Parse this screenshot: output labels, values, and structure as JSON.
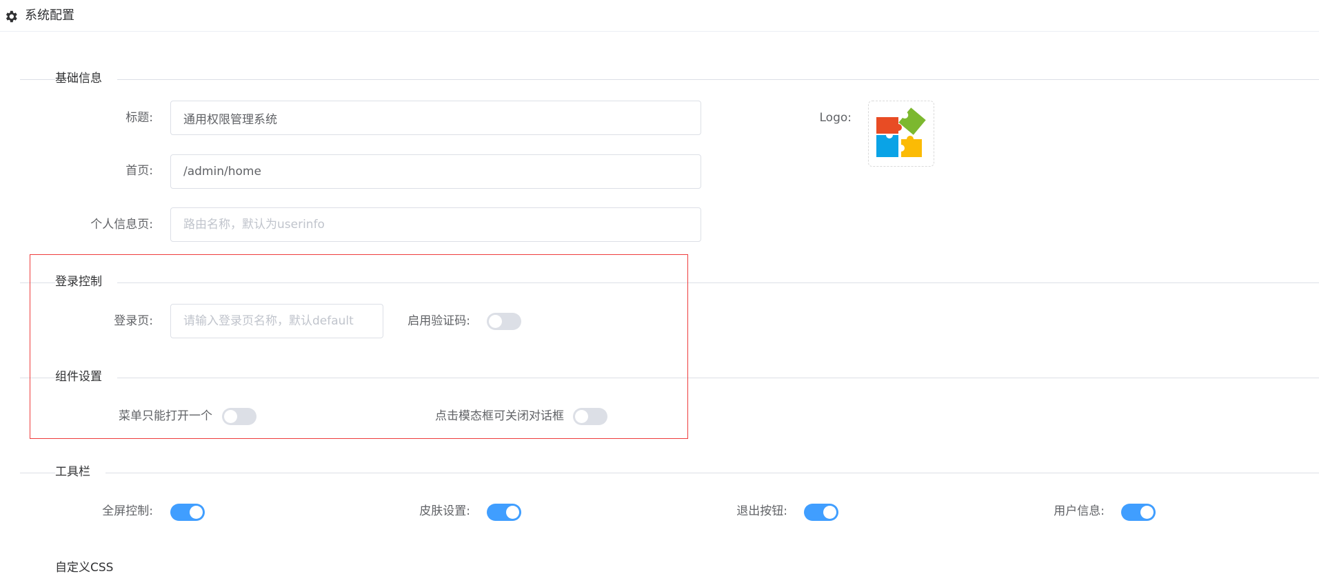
{
  "header": {
    "title": "系统配置",
    "icon": "gear-icon"
  },
  "sections": {
    "basic": "基础信息",
    "login": "登录控制",
    "component": "组件设置",
    "toolbar": "工具栏",
    "custom_css": "自定义CSS"
  },
  "basic": {
    "title_label": "标题:",
    "title_value": "通用权限管理系统",
    "home_label": "首页:",
    "home_value": "/admin/home",
    "profile_label": "个人信息页:",
    "profile_placeholder": "路由名称，默认为userinfo",
    "logo_label": "Logo:"
  },
  "login": {
    "page_label": "登录页:",
    "page_placeholder": "请输入登录页名称，默认default",
    "captcha_label": "启用验证码:",
    "captcha_enabled": false
  },
  "component": {
    "single_menu_label": "菜单只能打开一个",
    "single_menu_enabled": false,
    "modal_close_label": "点击模态框可关闭对话框",
    "modal_close_enabled": false
  },
  "toolbar": {
    "fullscreen_label": "全屏控制:",
    "fullscreen_enabled": true,
    "skin_label": "皮肤设置:",
    "skin_enabled": true,
    "logout_label": "退出按钮:",
    "logout_enabled": true,
    "userinfo_label": "用户信息:",
    "userinfo_enabled": true
  },
  "colors": {
    "accent": "#409eff",
    "switch_off": "#dcdfe6",
    "highlight": "#ee3b3b"
  }
}
